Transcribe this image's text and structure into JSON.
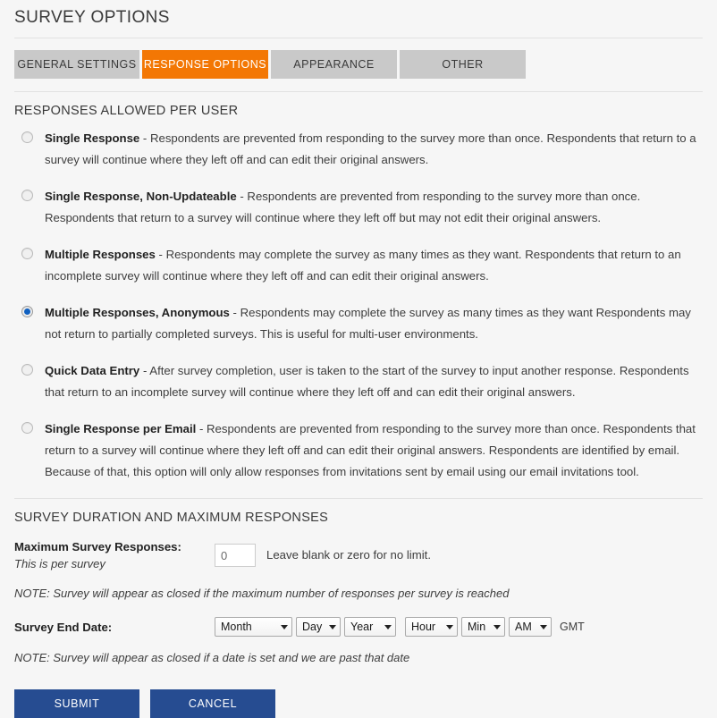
{
  "header": {
    "title": "SURVEY OPTIONS"
  },
  "tabs": [
    {
      "label": "GENERAL SETTINGS",
      "active": false
    },
    {
      "label": "RESPONSE OPTIONS",
      "active": true
    },
    {
      "label": "APPEARANCE",
      "active": false
    },
    {
      "label": "OTHER",
      "active": false
    }
  ],
  "responses_section": {
    "title": "RESPONSES ALLOWED PER USER",
    "options": [
      {
        "label": "Single Response",
        "description": " - Respondents are prevented from responding to the survey more than once. Respondents that return to a survey will continue where they left off and can edit their original answers.",
        "selected": false
      },
      {
        "label": "Single Response, Non-Updateable",
        "description": " - Respondents are prevented from responding to the survey more than once. Respondents that return to a survey will continue where they left off but may not edit their original answers.",
        "selected": false
      },
      {
        "label": "Multiple Responses",
        "description": " - Respondents may complete the survey as many times as they want. Respondents that return to an incomplete survey will continue where they left off and can edit their original answers.",
        "selected": false
      },
      {
        "label": "Multiple Responses, Anonymous",
        "description": " - Respondents may complete the survey as many times as they want Respondents may not return to partially completed surveys. This is useful for multi-user environments.",
        "selected": true
      },
      {
        "label": "Quick Data Entry",
        "description": " - After survey completion, user is taken to the start of the survey to input another response. Respondents that return to an incomplete survey will continue where they left off and can edit their original answers.",
        "selected": false
      },
      {
        "label": "Single Response per Email",
        "description": " - Respondents are prevented from responding to the survey more than once. Respondents that return to a survey will continue where they left off and can edit their original answers. Respondents are identified by email. Because of that, this option will only allow responses from invitations sent by email using our email invitations tool.",
        "selected": false
      }
    ]
  },
  "duration_section": {
    "title": "SURVEY DURATION AND MAXIMUM RESPONSES",
    "max_responses": {
      "label": "Maximum Survey Responses:",
      "sublabel": "This is per survey",
      "value": "0",
      "placeholder": "",
      "hint": "Leave blank or zero for no limit.",
      "note": "NOTE: Survey will appear as closed if the maximum number of responses per survey is reached"
    },
    "end_date": {
      "label": "Survey End Date:",
      "month": "Month",
      "day": "Day",
      "year": "Year",
      "hour": "Hour",
      "minute": "Min",
      "ampm": "AM",
      "timezone": "GMT",
      "note": "NOTE: Survey will appear as closed if a date is set and we are past that date"
    }
  },
  "actions": {
    "submit": "SUBMIT",
    "cancel": "CANCEL"
  },
  "colors": {
    "accent_orange": "#f37704",
    "button_blue": "#264c91",
    "tab_gray": "#c9c9c9",
    "radio_blue": "#1060c0",
    "page_bg": "#f6f6f6"
  }
}
